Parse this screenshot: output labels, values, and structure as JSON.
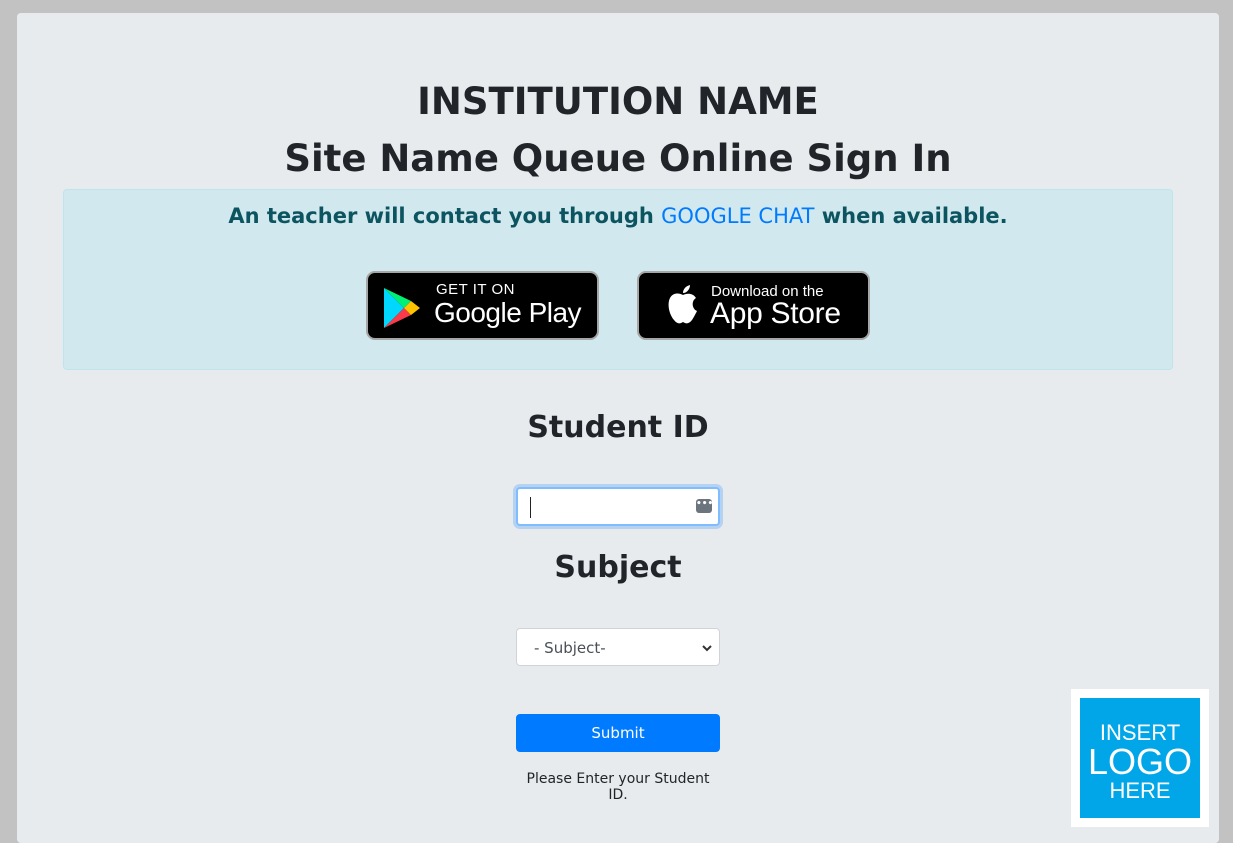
{
  "header": {
    "institution": "INSTITUTION NAME",
    "site_title": "Site Name Queue Online Sign In"
  },
  "info": {
    "text_before": "An teacher will contact you through ",
    "highlight": "GOOGLE CHAT",
    "text_after": " when available.",
    "google_play": {
      "small": "GET IT ON",
      "big": "Google Play"
    },
    "app_store": {
      "small": "Download on the",
      "big": "App Store"
    }
  },
  "form": {
    "student_id_label": "Student ID",
    "student_id_value": "",
    "subject_label": "Subject",
    "subject_selected": "- Subject-",
    "submit_label": "Submit",
    "help_text": "Please Enter your Student ID."
  },
  "logo": {
    "line1": "INSERT",
    "line2": "LOGO",
    "line3": "HERE"
  },
  "colors": {
    "page_bg": "#c2c2c2",
    "card_bg": "#e8ebee",
    "info_bg": "#d1e9ee",
    "info_text": "#0c5460",
    "accent": "#007bff",
    "logo_bg": "#00a6e8"
  }
}
